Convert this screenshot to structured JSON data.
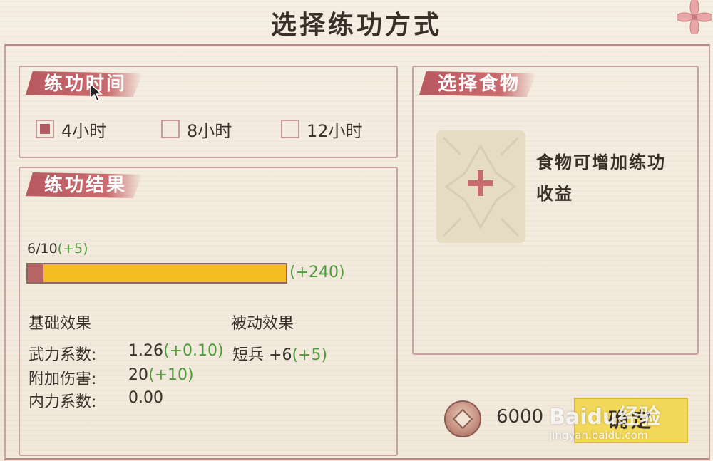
{
  "title": "选择练功方式",
  "train_time": {
    "header": "练功时间",
    "options": [
      {
        "label": "4小时",
        "checked": true
      },
      {
        "label": "8小时",
        "checked": false
      },
      {
        "label": "12小时",
        "checked": false
      }
    ]
  },
  "result": {
    "header": "练功结果",
    "progress_text": "6/10",
    "progress_bonus": "(+5)",
    "progress_current": 0.06,
    "progress_projected": 1.0,
    "bar_bonus": "(+240)",
    "base_title": "基础效果",
    "passive_title": "被动效果",
    "stats": [
      {
        "label": "武力系数:",
        "value": "1.26",
        "bonus": "(+0.10)"
      },
      {
        "label": "附加伤害:",
        "value": "20",
        "bonus": "(+10)"
      },
      {
        "label": "内力系数:",
        "value": "0.00",
        "bonus": ""
      }
    ],
    "passive": {
      "label": "短兵",
      "value": "+6",
      "bonus": "(+5)"
    }
  },
  "food": {
    "header": "选择食物",
    "hint": "食物可增加练功收益"
  },
  "cost": {
    "amount": "6000",
    "icon": "coin-icon"
  },
  "confirm_label": "确定",
  "watermark": {
    "brand": "Baidu经验",
    "url": "jingyan.baidu.com"
  },
  "colors": {
    "accent": "#b8585f",
    "bonus_green": "#4e9b3c",
    "progress": "#f5bd22",
    "confirm": "#f3d95a"
  }
}
